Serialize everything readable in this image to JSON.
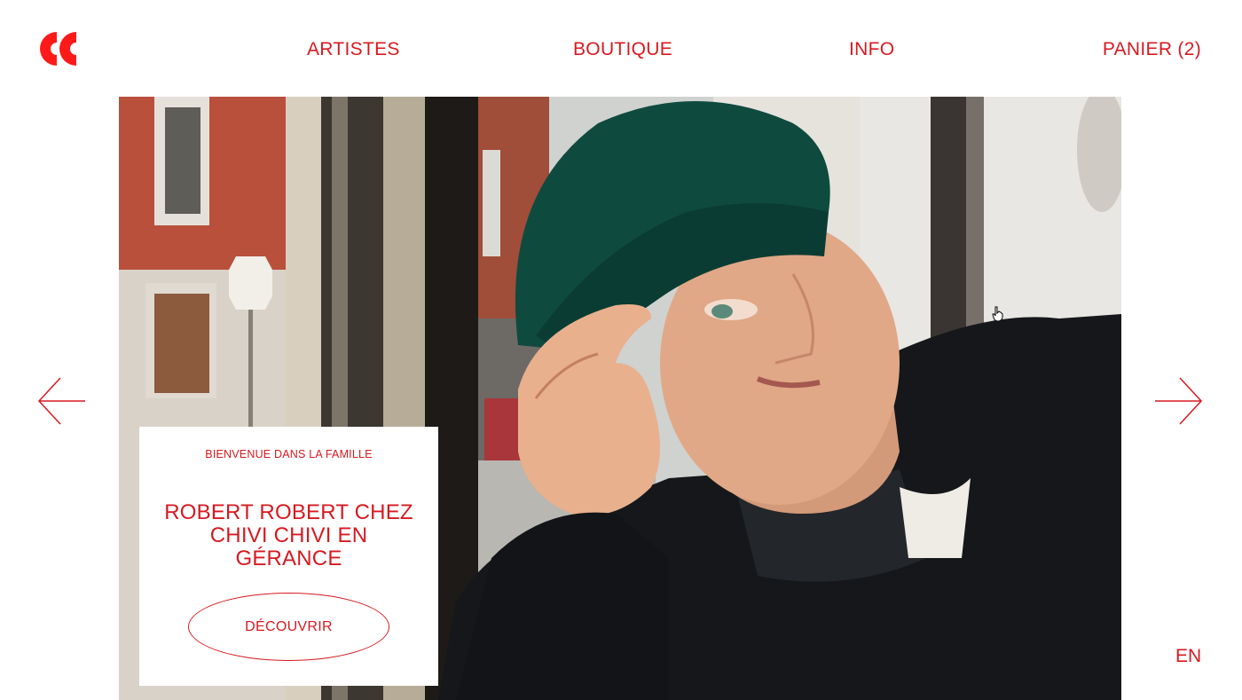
{
  "header": {
    "logo_icon": "double-c-logo-icon",
    "nav": {
      "artistes": "ARTISTES",
      "boutique": "BOUTIQUE",
      "info": "INFO",
      "cart": "PANIER (2)"
    }
  },
  "hero": {
    "image": "portrait-man-green-beanie-window",
    "prev_icon": "arrow-left-icon",
    "next_icon": "arrow-right-icon"
  },
  "card": {
    "eyebrow": "BIENVENUE DANS LA FAMILLE",
    "title": "ROBERT ROBERT CHEZ CHIVI CHIVI EN GÉRANCE",
    "cta": "DÉCOUVRIR"
  },
  "language": "EN",
  "colors": {
    "accent": "#d71920",
    "background": "#ffffff"
  }
}
